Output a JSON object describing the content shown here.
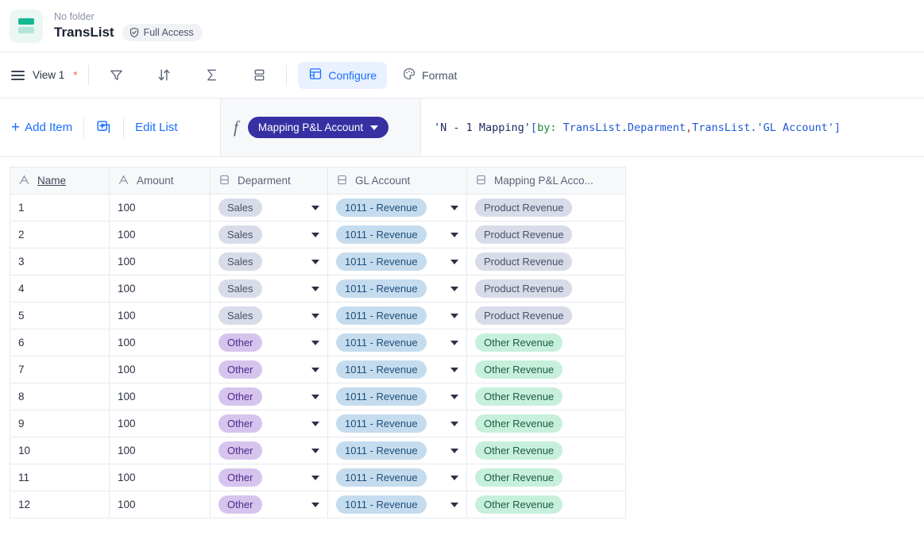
{
  "header": {
    "folder_label": "No folder",
    "doc_title": "TransList",
    "access_badge": "Full Access",
    "logo_icon": "list-app-icon",
    "shield_icon": "shield-check-icon"
  },
  "toolbar": {
    "menu_icon": "hamburger-menu-icon",
    "view_name": "View 1",
    "modified_marker": "*",
    "icons": [
      {
        "name": "filter-icon",
        "label": "Filter"
      },
      {
        "name": "sort-icon",
        "label": "Sort"
      },
      {
        "name": "summarize-icon",
        "label": "Summarize"
      },
      {
        "name": "group-rows-icon",
        "label": "Group"
      }
    ],
    "configure_label": "Configure",
    "configure_icon": "table-configure-icon",
    "format_label": "Format",
    "format_icon": "palette-icon",
    "accent_color": "#1a6dff",
    "active_bg": "#e9f1ff"
  },
  "actionbar": {
    "add_item_label": "Add Item",
    "add_item_icon": "plus-icon",
    "duplicate_icon": "duplicate-add-icon",
    "edit_list_label": "Edit List",
    "fx_icon": "function-fx-icon",
    "field_pill_label": "Mapping P&L Account",
    "field_pill_caret": "chevron-down-icon",
    "field_pill_color": "#3730a3",
    "formula": {
      "full_text": "'N - 1 Mapping'[by: TransList.Deparment,TransList.'GL Account']",
      "tokens": [
        {
          "t": "'N - 1 Mapping'",
          "c": "tk-str"
        },
        {
          "t": "[",
          "c": "tk-brk"
        },
        {
          "t": "by:",
          "c": "tk-kw"
        },
        {
          "t": " ",
          "c": "tk-str"
        },
        {
          "t": "TransList.Deparment",
          "c": "tk-ref"
        },
        {
          "t": ",",
          "c": "tk-pun"
        },
        {
          "t": "TransList.'GL Account'",
          "c": "tk-ref"
        },
        {
          "t": "]",
          "c": "tk-brk"
        }
      ]
    }
  },
  "table": {
    "columns": [
      {
        "label": "Name",
        "icon": "text-field-icon",
        "underline": true
      },
      {
        "label": "Amount",
        "icon": "text-field-icon",
        "underline": false
      },
      {
        "label": "Deparment",
        "icon": "select-field-icon",
        "underline": false
      },
      {
        "label": "GL Account",
        "icon": "select-field-icon",
        "underline": false
      },
      {
        "label": "Mapping P&L Acco...",
        "icon": "select-field-icon",
        "underline": false
      }
    ],
    "rows": [
      {
        "name": "1",
        "amount": "100",
        "deparment": "Sales",
        "deparment_color": "tag-gray",
        "gl_account": "1011 - Revenue",
        "mapping": "Product Revenue",
        "mapping_color": "tag-lgray"
      },
      {
        "name": "2",
        "amount": "100",
        "deparment": "Sales",
        "deparment_color": "tag-gray",
        "gl_account": "1011 - Revenue",
        "mapping": "Product Revenue",
        "mapping_color": "tag-lgray"
      },
      {
        "name": "3",
        "amount": "100",
        "deparment": "Sales",
        "deparment_color": "tag-gray",
        "gl_account": "1011 - Revenue",
        "mapping": "Product Revenue",
        "mapping_color": "tag-lgray"
      },
      {
        "name": "4",
        "amount": "100",
        "deparment": "Sales",
        "deparment_color": "tag-gray",
        "gl_account": "1011 - Revenue",
        "mapping": "Product Revenue",
        "mapping_color": "tag-lgray"
      },
      {
        "name": "5",
        "amount": "100",
        "deparment": "Sales",
        "deparment_color": "tag-gray",
        "gl_account": "1011 - Revenue",
        "mapping": "Product Revenue",
        "mapping_color": "tag-lgray"
      },
      {
        "name": "6",
        "amount": "100",
        "deparment": "Other",
        "deparment_color": "tag-purple",
        "gl_account": "1011 - Revenue",
        "mapping": "Other Revenue",
        "mapping_color": "tag-green"
      },
      {
        "name": "7",
        "amount": "100",
        "deparment": "Other",
        "deparment_color": "tag-purple",
        "gl_account": "1011 - Revenue",
        "mapping": "Other Revenue",
        "mapping_color": "tag-green"
      },
      {
        "name": "8",
        "amount": "100",
        "deparment": "Other",
        "deparment_color": "tag-purple",
        "gl_account": "1011 - Revenue",
        "mapping": "Other Revenue",
        "mapping_color": "tag-green"
      },
      {
        "name": "9",
        "amount": "100",
        "deparment": "Other",
        "deparment_color": "tag-purple",
        "gl_account": "1011 - Revenue",
        "mapping": "Other Revenue",
        "mapping_color": "tag-green"
      },
      {
        "name": "10",
        "amount": "100",
        "deparment": "Other",
        "deparment_color": "tag-purple",
        "gl_account": "1011 - Revenue",
        "mapping": "Other Revenue",
        "mapping_color": "tag-green"
      },
      {
        "name": "11",
        "amount": "100",
        "deparment": "Other",
        "deparment_color": "tag-purple",
        "gl_account": "1011 - Revenue",
        "mapping": "Other Revenue",
        "mapping_color": "tag-green"
      },
      {
        "name": "12",
        "amount": "100",
        "deparment": "Other",
        "deparment_color": "tag-purple",
        "gl_account": "1011 - Revenue",
        "mapping": "Other Revenue",
        "mapping_color": "tag-green"
      }
    ]
  }
}
